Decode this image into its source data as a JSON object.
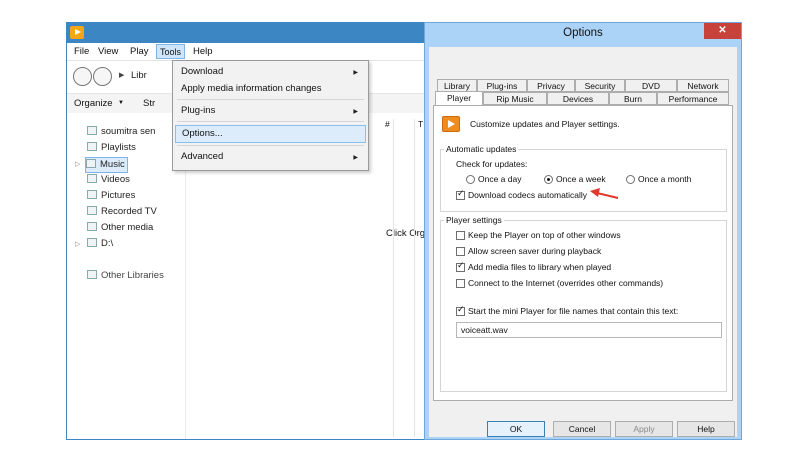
{
  "wmp": {
    "menu": {
      "file": "File",
      "view": "View",
      "play": "Play",
      "tools": "Tools",
      "help": "Help"
    },
    "breadcrumb": "Libr",
    "toolbar": {
      "organize": "Organize",
      "streams": "Str"
    },
    "col_headers": [
      "#",
      "T"
    ],
    "sidebar": [
      {
        "label": "soumitra sen"
      },
      {
        "label": "Playlists"
      },
      {
        "label": "Music"
      },
      {
        "label": "Videos"
      },
      {
        "label": "Pictures"
      },
      {
        "label": "Recorded TV"
      },
      {
        "label": "Other media"
      },
      {
        "label": "D:\\"
      },
      {
        "label": "Other Libraries"
      }
    ],
    "content_text": "Click Org"
  },
  "tools_menu": {
    "items": [
      {
        "label": "Download",
        "submenu": true
      },
      {
        "label": "Apply media information changes",
        "submenu": false
      },
      {
        "label": "Plug-ins",
        "submenu": true
      },
      {
        "label": "Options...",
        "submenu": false
      },
      {
        "label": "Advanced",
        "submenu": true
      }
    ]
  },
  "options": {
    "title": "Options",
    "close": "✕",
    "tabs_row1": [
      "Library",
      "Plug-ins",
      "Privacy",
      "Security",
      "DVD",
      "Network"
    ],
    "tabs_row2": [
      "Player",
      "Rip Music",
      "Devices",
      "Burn",
      "Performance"
    ],
    "description": "Customize updates and Player settings.",
    "auto_updates": {
      "group": "Automatic updates",
      "check_label": "Check for updates:",
      "radios": [
        {
          "label": "Once a day",
          "checked": false
        },
        {
          "label": "Once a week",
          "checked": true
        },
        {
          "label": "Once a month",
          "checked": false
        }
      ],
      "download_codecs": "Download codecs automatically"
    },
    "player_settings": {
      "group": "Player settings",
      "checks": [
        {
          "label": "Keep the Player on top of other windows",
          "checked": false
        },
        {
          "label": "Allow screen saver during playback",
          "checked": false
        },
        {
          "label": "Add media files to library when played",
          "checked": true
        },
        {
          "label": "Connect to the Internet (overrides other commands)",
          "checked": false
        }
      ],
      "mini_player": "Start the mini Player for file names that contain this text:",
      "mini_player_value": "voiceatt.wav"
    },
    "buttons": {
      "ok": "OK",
      "cancel": "Cancel",
      "apply": "Apply",
      "help": "Help"
    }
  },
  "colors": {
    "annotation_arrow": "#e0392b",
    "title_bar": "#3d86c4",
    "dialog_frame": "#aad3f7"
  }
}
